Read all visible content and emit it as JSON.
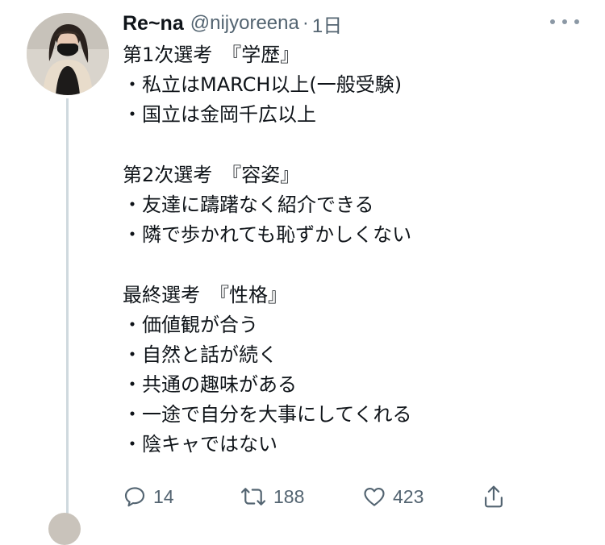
{
  "tweet": {
    "display_name": "Re~na",
    "handle": "@nijyoreena",
    "separator": "·",
    "time": "1日",
    "lines": [
      "第1次選考　『学歴』",
      "・私立はMARCH以上(一般受験)",
      "・国立は金岡千広以上",
      "",
      "第2次選考　『容姿』",
      "・友達に躊躇なく紹介できる",
      "・隣で歩かれても恥ずかしくない",
      "",
      "最終選考　『性格』",
      "・価値観が合う",
      "・自然と話が続く",
      "・共通の趣味がある",
      "・一途で自分を大事にしてくれる",
      "・陰キャではない"
    ],
    "actions": {
      "reply_count": "14",
      "retweet_count": "188",
      "like_count": "423"
    }
  },
  "icons": {
    "more": "more-horizontal-icon",
    "reply": "reply-icon",
    "retweet": "retweet-icon",
    "like": "heart-icon",
    "share": "share-icon"
  },
  "colors": {
    "text_primary": "#0f1419",
    "text_secondary": "#536471",
    "thread_line": "#cfd9de"
  }
}
